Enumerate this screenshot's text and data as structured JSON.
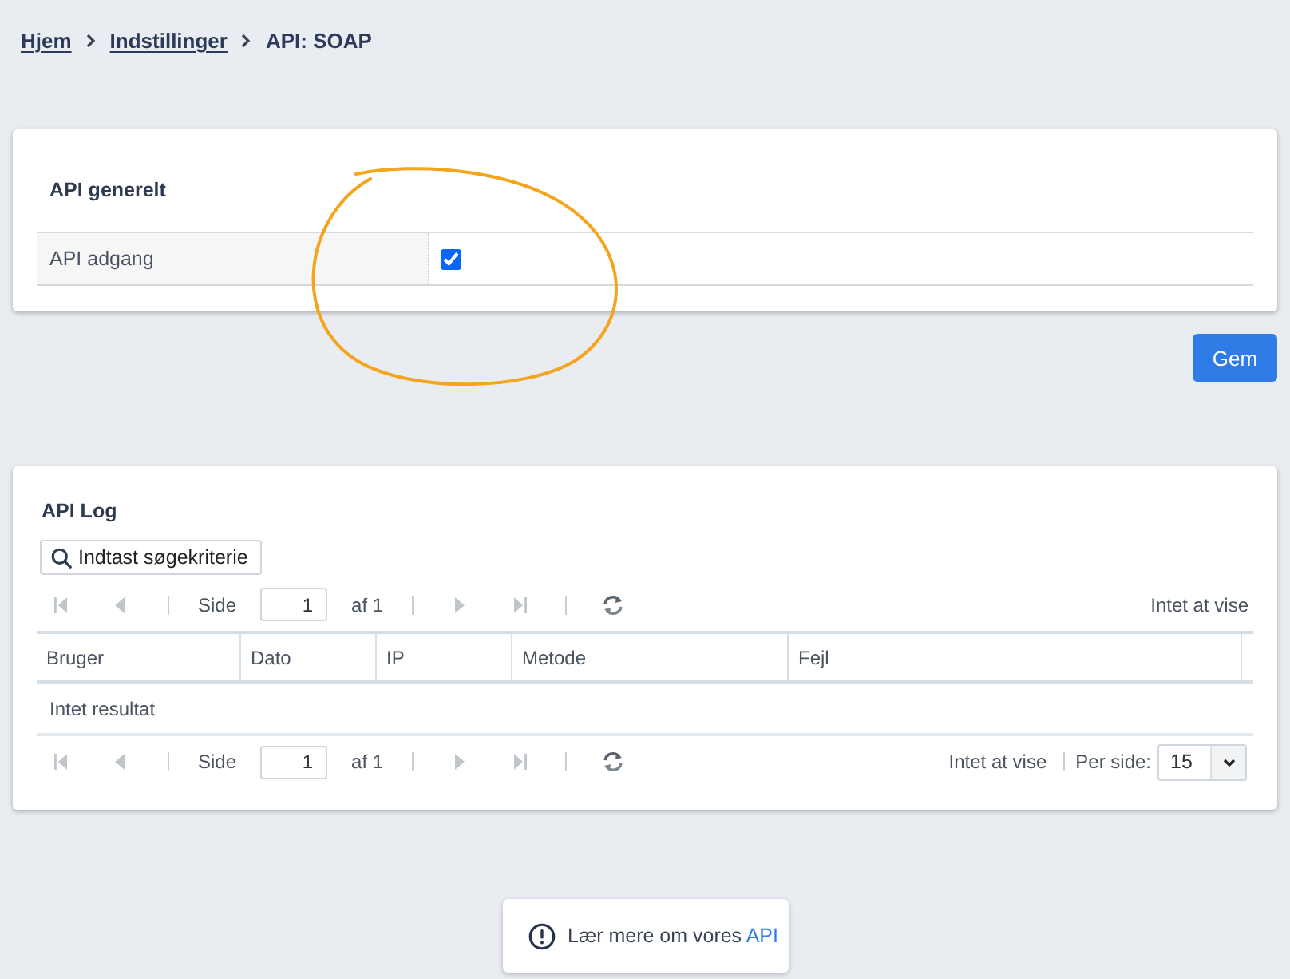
{
  "breadcrumb": [
    {
      "label": "Hjem",
      "kind": "link"
    },
    {
      "label": "Indstillinger",
      "kind": "link"
    },
    {
      "label": "API: SOAP",
      "kind": "current"
    }
  ],
  "general": {
    "title": "API generelt",
    "fields": [
      {
        "label": "API adgang",
        "checked": true
      }
    ]
  },
  "save_button": "Gem",
  "log": {
    "title": "API Log",
    "search": {
      "placeholder": "Indtast søgekriterie"
    },
    "top_pager": {
      "nav_disabled": true,
      "page_label": "Side",
      "page": "1",
      "of": "af 1",
      "status": "Intet at vise"
    },
    "columns": [
      "Bruger",
      "Dato",
      "IP",
      "Metode",
      "Fejl"
    ],
    "empty_text": "Intet resultat",
    "bottom_pager": {
      "nav_disabled": true,
      "page_label": "Side",
      "page": "1",
      "of": "af 1",
      "status": "Intet at vise",
      "per_page_label": "Per side:",
      "per_page": "15"
    }
  },
  "info": {
    "text": "Lær mere om vores",
    "link": "API"
  }
}
